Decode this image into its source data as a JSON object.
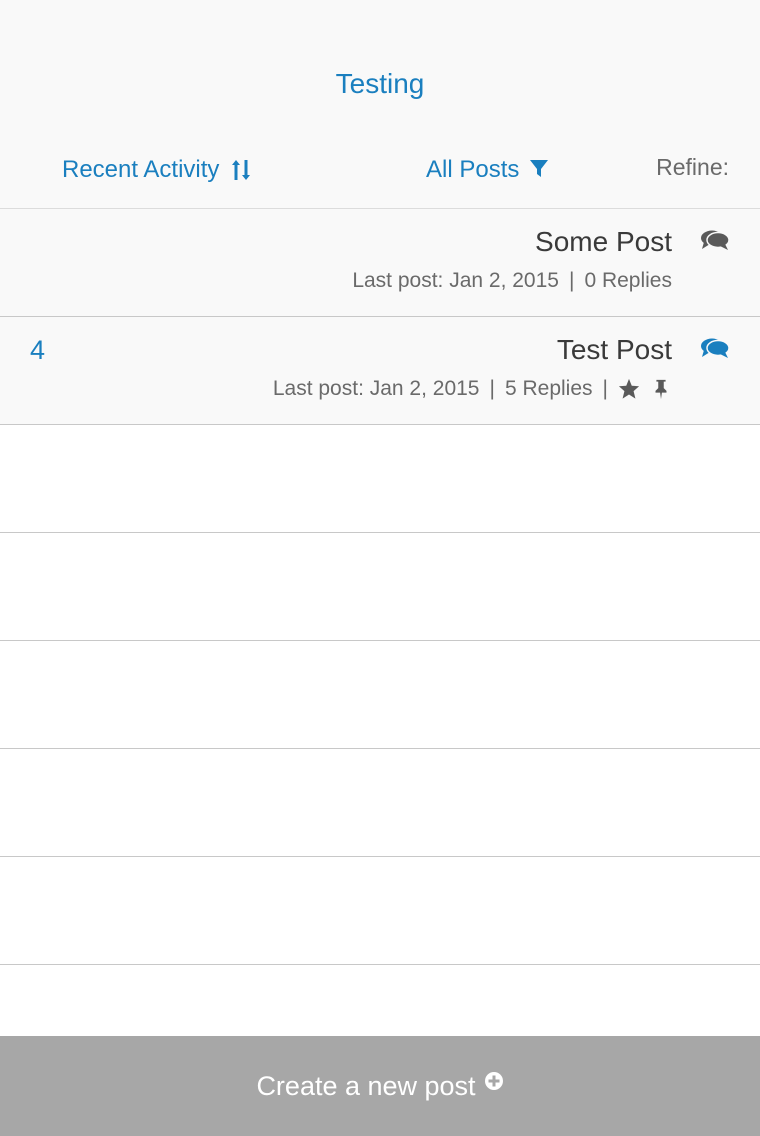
{
  "header": {
    "title": "Testing",
    "sort_label": "Recent Activity",
    "filter_label": "All Posts",
    "refine_label": "Refine:"
  },
  "posts": [
    {
      "count": "",
      "title": "Some Post",
      "last_post": "Last post: Jan 2, 2015",
      "replies": "0 Replies",
      "separator": "|",
      "icon_color": "#5a5a5a"
    },
    {
      "count": "4",
      "title": "Test Post",
      "last_post": "Last post: Jan 2, 2015",
      "replies": "5 Replies",
      "separator": "|",
      "icon_color": "#1a7fbf",
      "icons": [
        "star-icon",
        "pin-icon"
      ]
    }
  ],
  "footer": {
    "create_label": "Create a new post"
  },
  "colors": {
    "accent": "#1a7fbf",
    "footer_bg": "#a7a7a7",
    "text_dark": "#3a3a3a",
    "text_muted": "#6a6a6a"
  }
}
